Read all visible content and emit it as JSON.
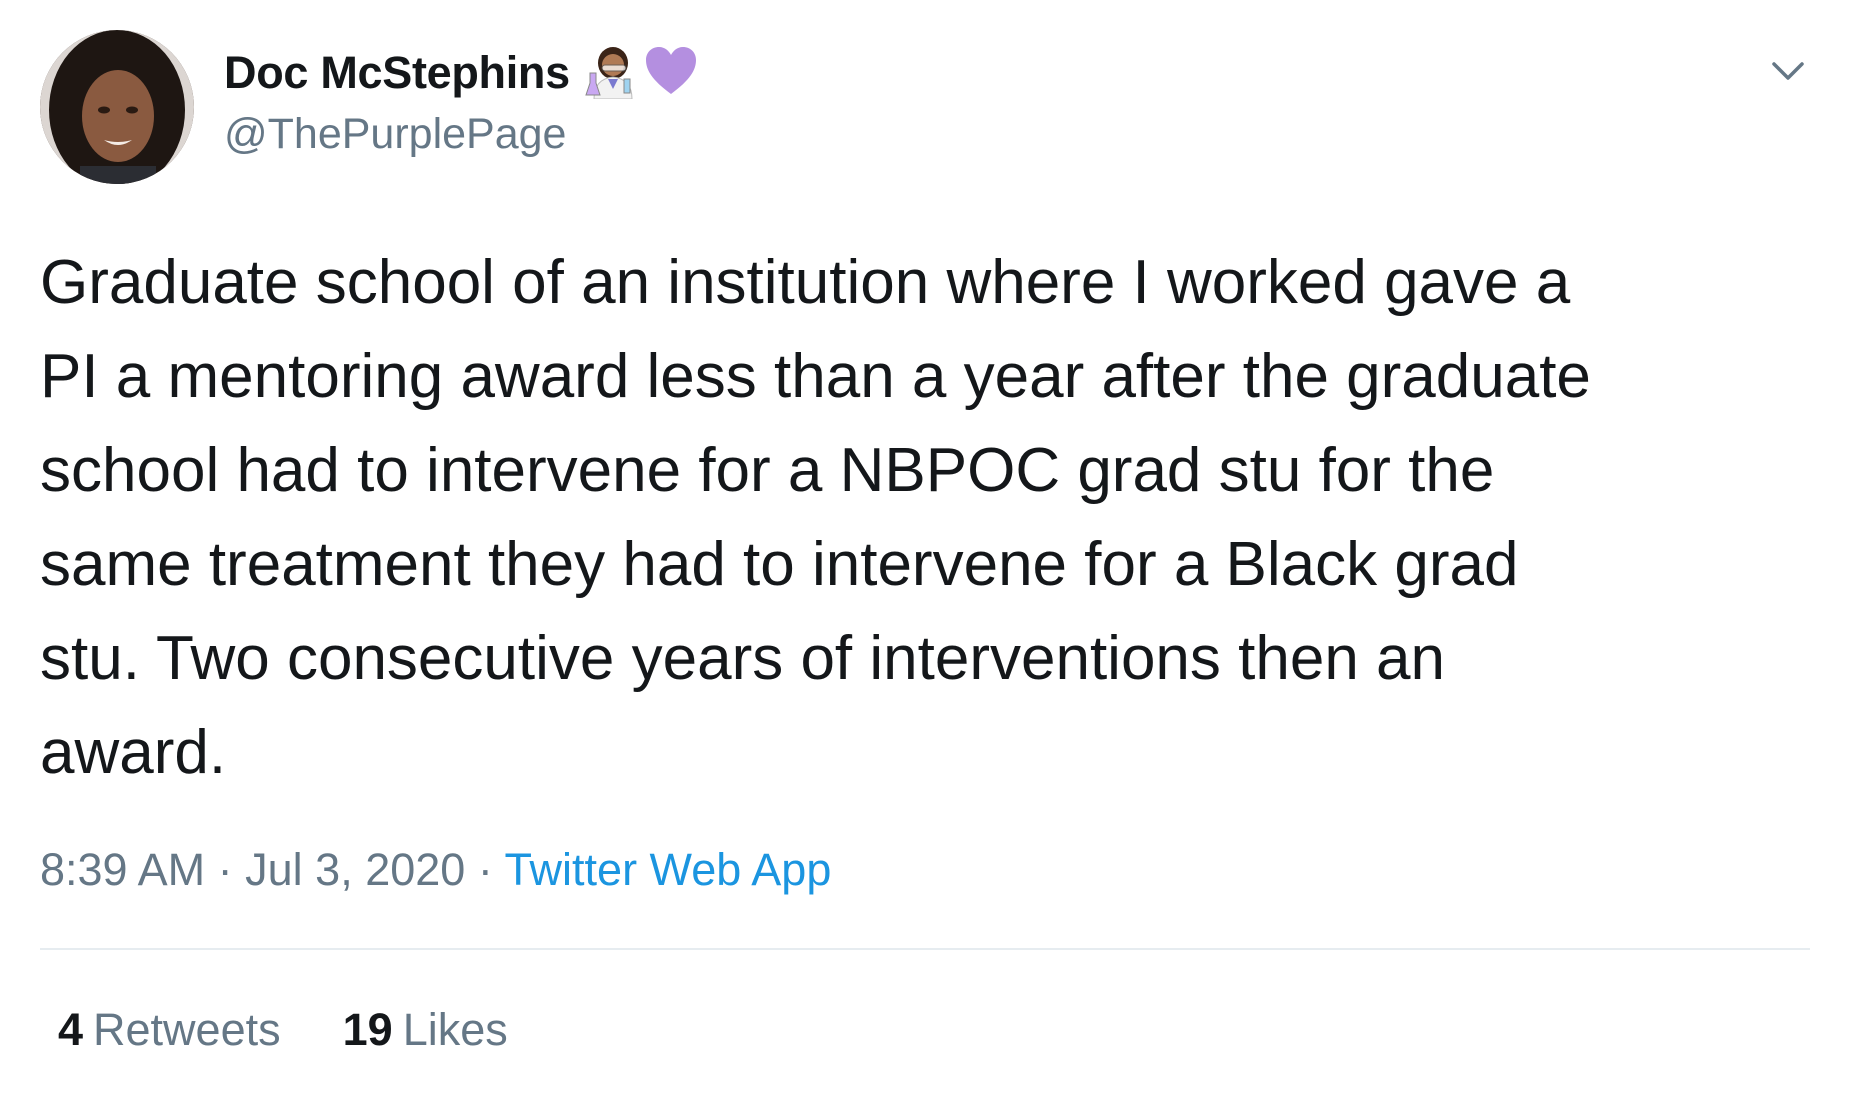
{
  "tweet": {
    "display_name": "Doc McStephins",
    "name_emojis": [
      "scientist-woman-icon",
      "purple-heart-icon"
    ],
    "handle": "@ThePurplePage",
    "text_lines": [
      "Graduate school of an institution where I worked gave a",
      "PI a mentoring award less than a year after the graduate",
      "school had to intervene for a NBPOC grad stu for the",
      "same treatment they had to intervene for a Black grad",
      "stu. Two consecutive years of interventions then an",
      "award."
    ],
    "time": "8:39 AM",
    "separator": "·",
    "date": "Jul 3, 2020",
    "source": "Twitter Web App",
    "retweets": {
      "count": "4",
      "label": "Retweets"
    },
    "likes": {
      "count": "19",
      "label": "Likes"
    }
  },
  "colors": {
    "text_primary": "#14171a",
    "text_secondary": "#657786",
    "link": "#1b95e0",
    "divider": "#e6ecf0",
    "heart": "#b48fe0"
  }
}
